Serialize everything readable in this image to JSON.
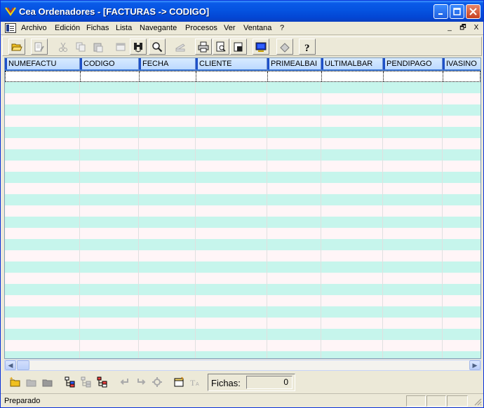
{
  "window": {
    "title": "Cea Ordenadores  - [FACTURAS -> CODIGO]",
    "minimize_icon": "minimize-icon",
    "maximize_icon": "maximize-icon",
    "close_icon": "close-icon"
  },
  "menu": {
    "items": [
      "Archivo",
      "Edición",
      "Fichas",
      "Lista",
      "Navegante",
      "Procesos",
      "Ver",
      "Ventana",
      "?"
    ],
    "mdi_controls": [
      "_",
      "🗗",
      "X"
    ]
  },
  "toolbar": {
    "icons": [
      "open-folder-icon",
      "edit-icon",
      "cut-icon",
      "copy-icon",
      "paste-icon",
      "window-icon",
      "find-icon",
      "zoom-icon",
      "scanner-icon",
      "print-icon",
      "print-preview-icon",
      "print-setup-icon",
      "monitor-icon",
      "eraser-icon",
      "help-icon"
    ]
  },
  "grid": {
    "columns": [
      "NUMEFACTU",
      "CODIGO",
      "FECHA",
      "CLIENTE",
      "PRIMEALBAI",
      "ULTIMALBAR",
      "PENDIPAGO",
      "IVASINO"
    ],
    "row_colors": [
      "#fff5f7",
      "#c6f5ec"
    ]
  },
  "bottom_toolbar": {
    "icons": [
      "new-folder-icon",
      "folder-icon",
      "folder-dark-icon",
      "tree-add-icon",
      "tree-icon",
      "tree-remove-icon",
      "undo-icon",
      "redo-icon",
      "settings-icon",
      "note-icon",
      "text-icon"
    ],
    "fichas_label": "Fichas:",
    "fichas_value": "0"
  },
  "status": {
    "text": "Preparado"
  }
}
